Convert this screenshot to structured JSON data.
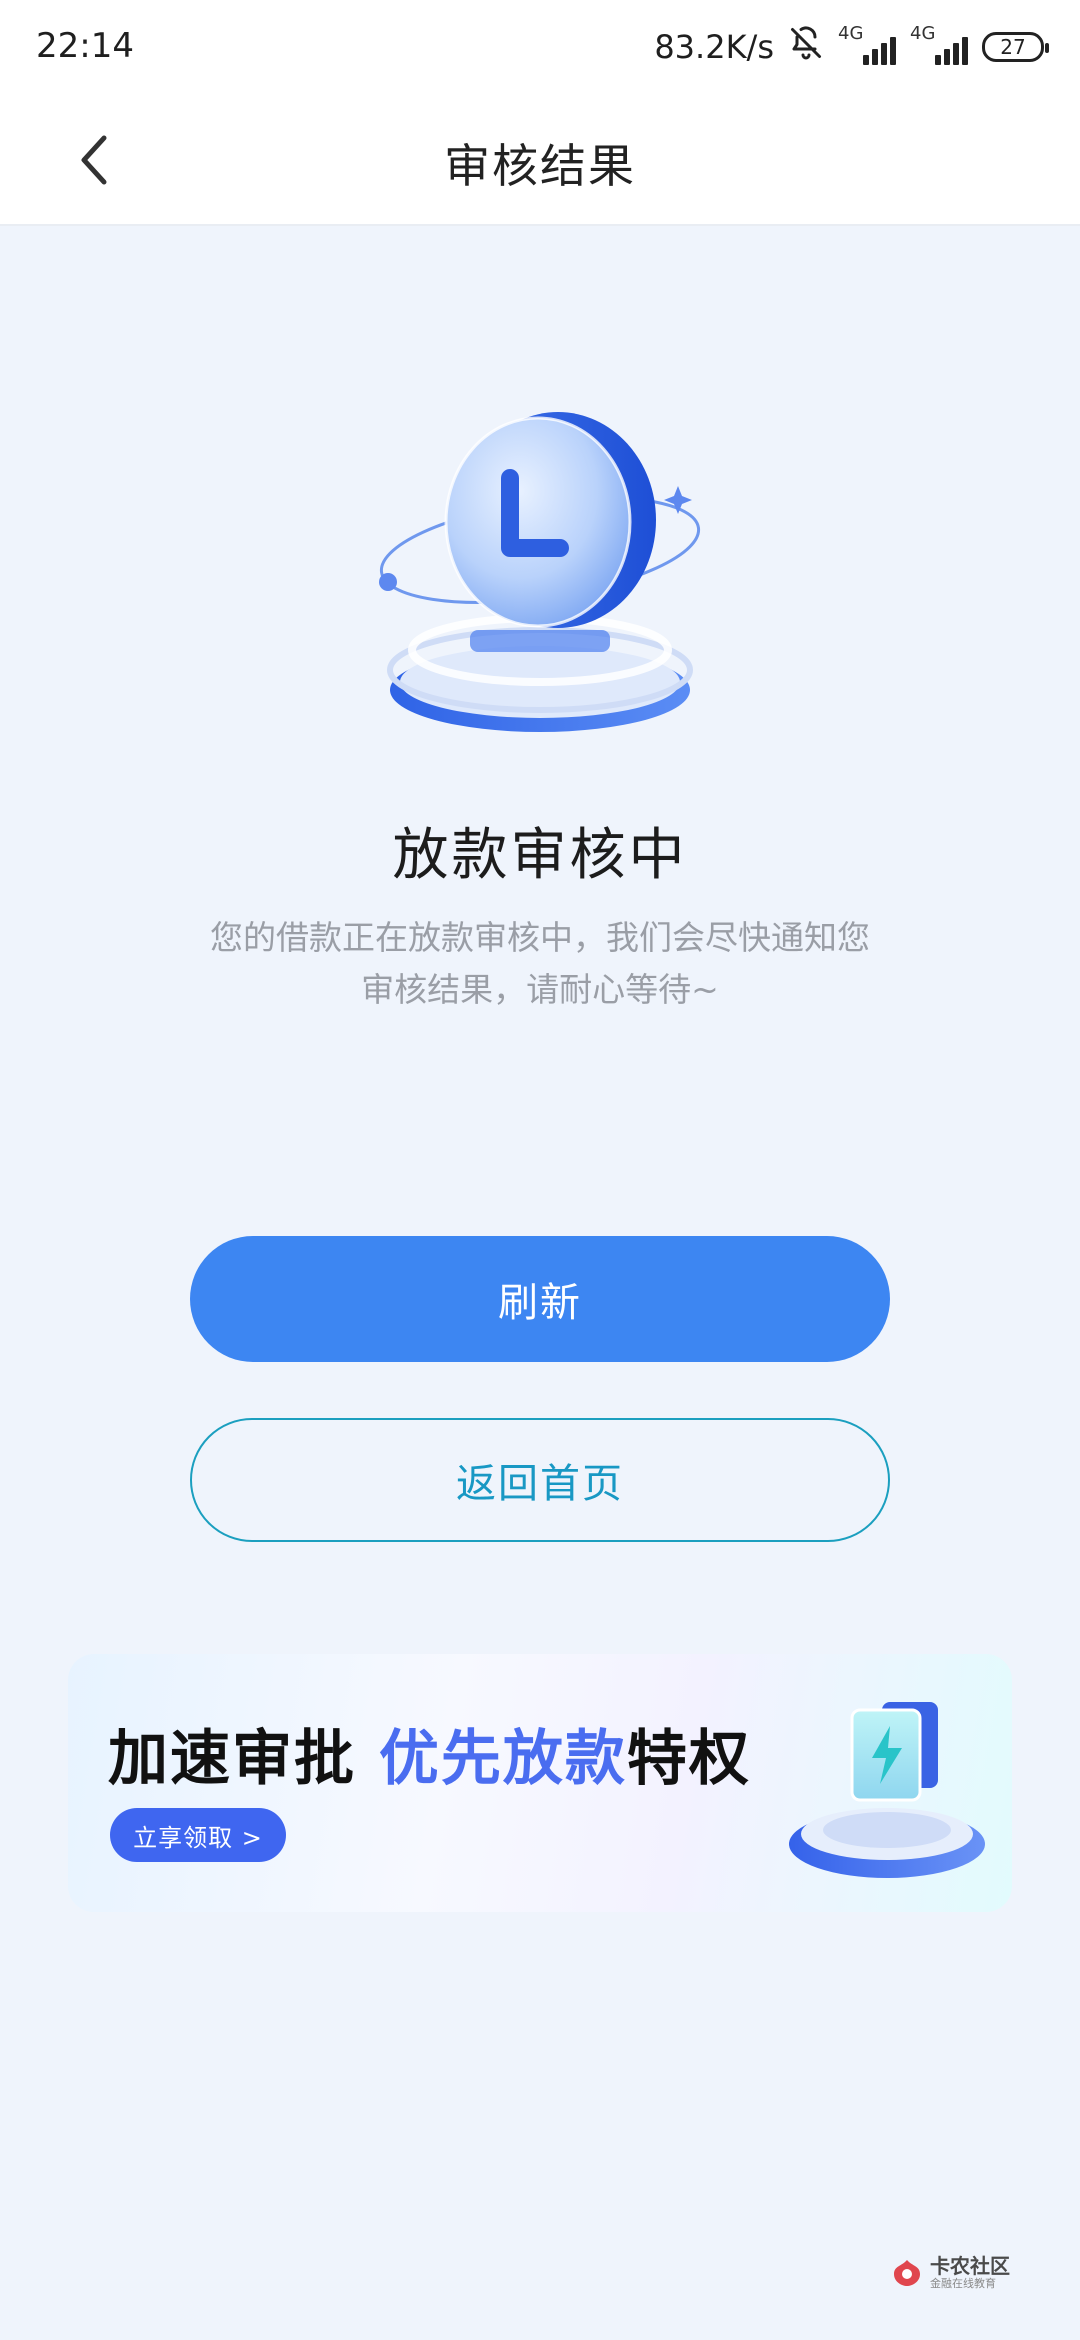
{
  "status_bar": {
    "time": "22:14",
    "speed": "83.2K/s",
    "network_1": "4G",
    "network_2": "4G",
    "battery": "27"
  },
  "nav": {
    "title": "审核结果"
  },
  "status": {
    "title": "放款审核中",
    "desc_line1": "您的借款正在放款审核中，我们会尽快通知您",
    "desc_line2": "审核结果，请耐心等待~"
  },
  "actions": {
    "refresh_label": "刷新",
    "home_label": "返回首页"
  },
  "banner": {
    "title_part1": "加速审批 ",
    "title_accent": "优先放款",
    "title_part2": "特权",
    "cta_label": "立享领取 >"
  },
  "watermark": {
    "line1": "卡农社区",
    "line2": "金融在线教育"
  },
  "colors": {
    "background": "#eff4fc",
    "primary": "#3d86f2",
    "secondary_border": "#1b9fbf",
    "accent": "#4a6df0"
  },
  "icons": {
    "back": "chevron-left-icon",
    "mute": "bell-off-icon",
    "hero": "clock-coin-icon",
    "banner": "lightning-card-icon"
  }
}
